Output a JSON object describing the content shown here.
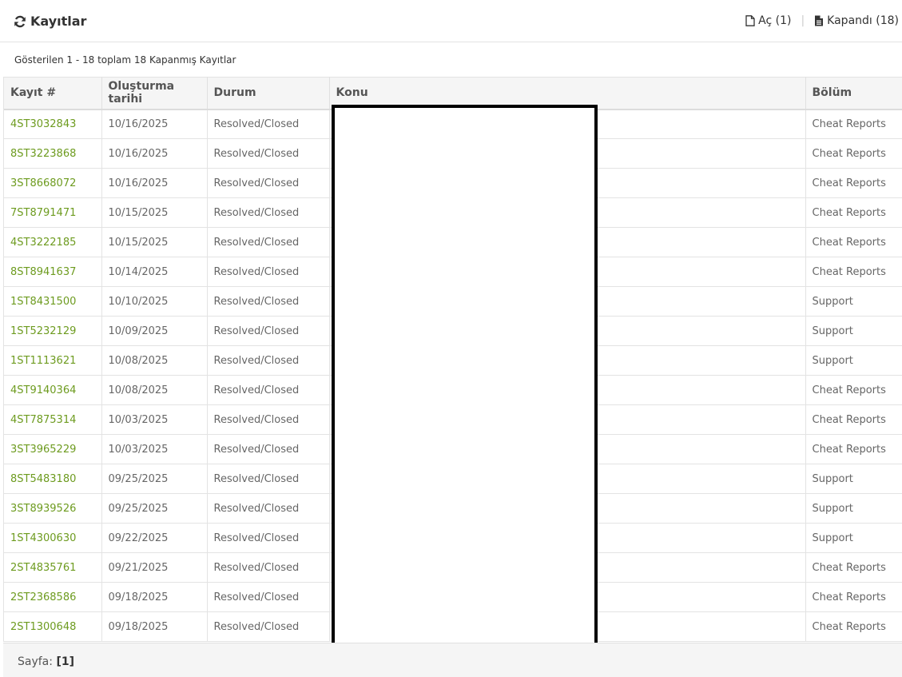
{
  "header": {
    "title": "Kayıtlar",
    "filters": [
      {
        "label": "Aç (1)"
      },
      {
        "label": "Kapandı (18)"
      }
    ]
  },
  "summary": "Gösterilen 1 - 18 toplam 18 Kapanmış Kayıtlar",
  "table": {
    "columns": [
      "Kayıt #",
      "Oluşturma tarihi",
      "Durum",
      "Konu",
      "Bölüm"
    ],
    "rows": [
      {
        "id": "4ST3032843",
        "date": "10/16/2025",
        "status": "Resolved/Closed",
        "subject": "",
        "dept": "Cheat Reports"
      },
      {
        "id": "8ST3223868",
        "date": "10/16/2025",
        "status": "Resolved/Closed",
        "subject": "",
        "dept": "Cheat Reports"
      },
      {
        "id": "3ST8668072",
        "date": "10/16/2025",
        "status": "Resolved/Closed",
        "subject": "",
        "dept": "Cheat Reports"
      },
      {
        "id": "7ST8791471",
        "date": "10/15/2025",
        "status": "Resolved/Closed",
        "subject": "",
        "dept": "Cheat Reports"
      },
      {
        "id": "4ST3222185",
        "date": "10/15/2025",
        "status": "Resolved/Closed",
        "subject": "",
        "dept": "Cheat Reports"
      },
      {
        "id": "8ST8941637",
        "date": "10/14/2025",
        "status": "Resolved/Closed",
        "subject": "",
        "dept": "Cheat Reports"
      },
      {
        "id": "1ST8431500",
        "date": "10/10/2025",
        "status": "Resolved/Closed",
        "subject": "",
        "dept": "Support"
      },
      {
        "id": "1ST5232129",
        "date": "10/09/2025",
        "status": "Resolved/Closed",
        "subject": "",
        "dept": "Support"
      },
      {
        "id": "1ST1113621",
        "date": "10/08/2025",
        "status": "Resolved/Closed",
        "subject": "",
        "dept": "Support"
      },
      {
        "id": "4ST9140364",
        "date": "10/08/2025",
        "status": "Resolved/Closed",
        "subject": "",
        "dept": "Cheat Reports"
      },
      {
        "id": "4ST7875314",
        "date": "10/03/2025",
        "status": "Resolved/Closed",
        "subject": "",
        "dept": "Cheat Reports"
      },
      {
        "id": "3ST3965229",
        "date": "10/03/2025",
        "status": "Resolved/Closed",
        "subject": "",
        "dept": "Cheat Reports"
      },
      {
        "id": "8ST5483180",
        "date": "09/25/2025",
        "status": "Resolved/Closed",
        "subject": "",
        "dept": "Support"
      },
      {
        "id": "3ST8939526",
        "date": "09/25/2025",
        "status": "Resolved/Closed",
        "subject": "",
        "dept": "Support"
      },
      {
        "id": "1ST4300630",
        "date": "09/22/2025",
        "status": "Resolved/Closed",
        "subject": "",
        "dept": "Support"
      },
      {
        "id": "2ST4835761",
        "date": "09/21/2025",
        "status": "Resolved/Closed",
        "subject": "",
        "dept": "Cheat Reports"
      },
      {
        "id": "2ST2368586",
        "date": "09/18/2025",
        "status": "Resolved/Closed",
        "subject": "",
        "dept": "Cheat Reports"
      },
      {
        "id": "2ST1300648",
        "date": "09/18/2025",
        "status": "Resolved/Closed",
        "subject": "",
        "dept": "Cheat Reports"
      }
    ]
  },
  "footer": {
    "page_label": "Sayfa:",
    "page_current": "[1]"
  },
  "colors": {
    "link": "#6d9b1f",
    "header_bg": "#f5f5f5"
  },
  "icons": {
    "title": "refresh-icon",
    "open_filter": "file-outline-icon",
    "closed_filter": "file-text-icon"
  }
}
